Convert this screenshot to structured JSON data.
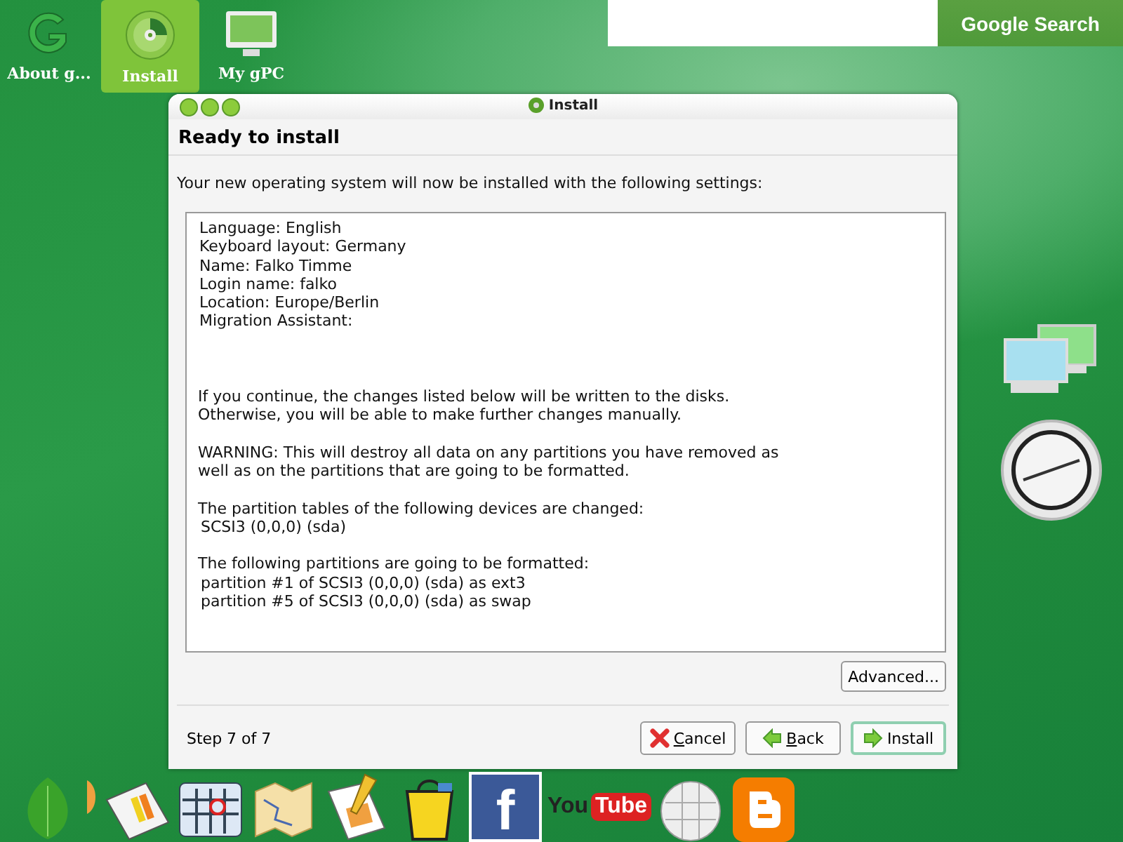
{
  "desktop_icons": [
    {
      "label": "About g...",
      "kind": "g-logo",
      "selected": false
    },
    {
      "label": "Install",
      "kind": "disc",
      "selected": true
    },
    {
      "label": "My gPC",
      "kind": "monitor",
      "selected": false
    }
  ],
  "search": {
    "button": "Google Search"
  },
  "window": {
    "title": "Install",
    "heading": "Ready to install",
    "intro": "Your new operating system will now be installed with the following settings:",
    "summary": [
      "Language: English",
      "Keyboard layout: Germany",
      "Name: Falko Timme",
      "Login name: falko",
      "Location: Europe/Berlin",
      "Migration Assistant:"
    ],
    "paragraphs": [
      {
        "lines": [
          "If you continue, the changes listed below will be written to the disks.",
          "Otherwise, you will be able to make further changes manually."
        ]
      },
      {
        "lines": [
          "WARNING: This will destroy all data on any partitions you have removed as",
          "well as on the partitions that are going to be formatted."
        ]
      },
      {
        "lines": [
          "The partition tables of the following devices are changed:"
        ],
        "items": [
          "SCSI3 (0,0,0) (sda)"
        ]
      },
      {
        "lines": [
          "The following partitions are going to be formatted:"
        ],
        "items": [
          "partition #1 of SCSI3 (0,0,0) (sda) as ext3",
          "partition #5 of SCSI3 (0,0,0) (sda) as swap"
        ]
      }
    ],
    "advanced": "Advanced...",
    "step": "Step 7 of 7",
    "buttons": [
      {
        "label": "Cancel",
        "kind": "cancel",
        "focused": false
      },
      {
        "label": "Back",
        "kind": "back",
        "focused": false
      },
      {
        "label": "Install",
        "kind": "forward",
        "focused": true
      }
    ]
  },
  "dock": [
    {
      "kind": "leaf"
    },
    {
      "kind": "tab"
    },
    {
      "kind": "news"
    },
    {
      "kind": "calendar"
    },
    {
      "kind": "map"
    },
    {
      "kind": "spreadsheet"
    },
    {
      "kind": "bag"
    },
    {
      "kind": "facebook",
      "text": "f"
    },
    {
      "kind": "youtube",
      "text": "You",
      "text2": "Tube"
    },
    {
      "kind": "globe"
    },
    {
      "kind": "blogger"
    }
  ]
}
